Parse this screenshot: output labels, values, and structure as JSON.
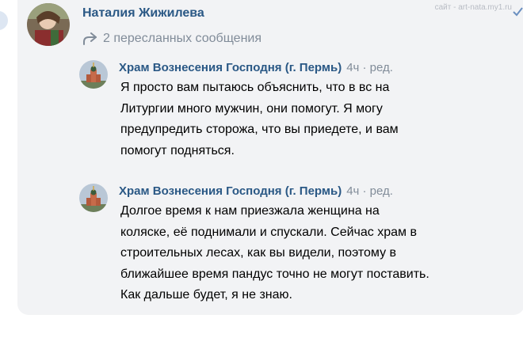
{
  "header": {
    "sender_name": "Наталия Жижилева",
    "watermark": "сайт - art-nata.my1.ru"
  },
  "forward": {
    "icon": "forward-arrow-icon",
    "label": "2 пересланных сообщения"
  },
  "messages": [
    {
      "author": "Храм Вознесения Господня (г. Пермь)",
      "meta": "4ч · ред.",
      "lines": [
        "Я просто вам пытаюсь объяснить, что в вс на",
        "Литургии много мужчин, они помогут. Я могу",
        "предупредить сторожа, что вы приедете, и вам",
        "помогут подняться."
      ]
    },
    {
      "author": "Храм Вознесения Господня (г. Пермь)",
      "meta": "4ч · ред.",
      "lines": [
        "Долгое время к нам приезжала женщина на",
        "коляске, её поднимали и спускали. Сейчас храм в",
        "строительных лесах, как вы видели, поэтому в",
        "ближайшее время пандус точно не могут поставить.",
        "Как дальше будет, я не знаю."
      ]
    }
  ],
  "colors": {
    "link": "#2a5885",
    "muted": "#818c99",
    "panel_bg": "#f2f3f5"
  }
}
